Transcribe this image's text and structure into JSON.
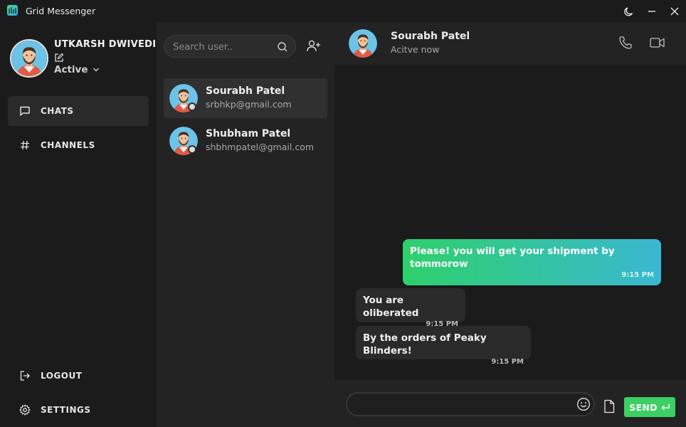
{
  "window": {
    "title": "Grid Messenger"
  },
  "profile": {
    "name": "UTKARSH DWIVEDI",
    "status": "Active"
  },
  "nav": {
    "items": [
      {
        "label": "CHATS",
        "icon": "chat-bubble-icon",
        "active": true
      },
      {
        "label": "CHANNELS",
        "icon": "hash-icon",
        "active": false
      }
    ],
    "logout_label": "LOGOUT",
    "settings_label": "SETTINGS"
  },
  "search": {
    "placeholder": "Search user.."
  },
  "contacts": [
    {
      "name": "Sourabh Patel",
      "email": "srbhkp@gmail.com",
      "active": true
    },
    {
      "name": "Shubham Patel",
      "email": "shbhmpatel@gmail.com",
      "active": false
    }
  ],
  "chat": {
    "name": "Sourabh Patel",
    "status": "Acitve now",
    "messages": [
      {
        "direction": "out",
        "text": "Please! you will get your shipment by tommorow",
        "time": "9:15 PM"
      },
      {
        "direction": "in",
        "text": "You are oliberated",
        "time": "9:15 PM"
      },
      {
        "direction": "in",
        "text": "By the orders of Peaky Blinders!",
        "time": "9:15 PM"
      }
    ]
  },
  "composer": {
    "value": "",
    "send_label": "SEND"
  },
  "colors": {
    "accent_green": "#3ccf63",
    "gradient_start": "#2ed06b",
    "gradient_end": "#3ab8d2"
  }
}
